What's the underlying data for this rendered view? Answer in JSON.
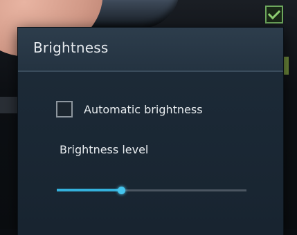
{
  "dialog": {
    "title": "Brightness",
    "auto_label": "Automatic brightness",
    "auto_checked": false,
    "level_label": "Brightness level",
    "level_fraction": 0.34
  },
  "colors": {
    "accent": "#34b1dc",
    "dialog_bg": "#17232e",
    "title_bg": "#2d3d4c"
  },
  "icons": {
    "background_check": "check-icon"
  }
}
